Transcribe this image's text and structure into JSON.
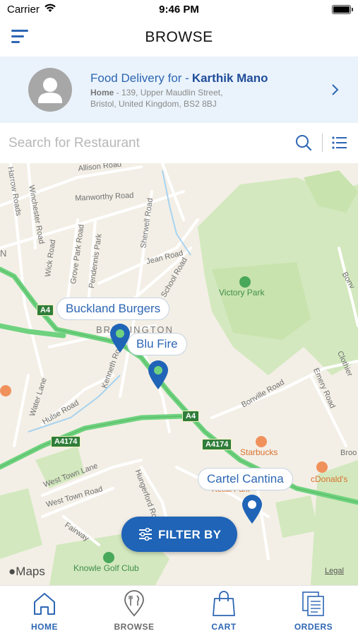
{
  "status_bar": {
    "carrier": "Carrier",
    "time": "9:46 PM"
  },
  "header": {
    "title": "BROWSE",
    "menu_icon": "hamburger-icon"
  },
  "delivery": {
    "prefix": "Food Delivery for -",
    "name": "Karthik Mano",
    "address_label": "Home",
    "address_line1": " - 139, Upper Maudlin Street,",
    "address_line2": "Bristol, United Kingdom, BS2 8BJ"
  },
  "search": {
    "placeholder": "Search for Restaurant"
  },
  "map": {
    "street_labels": {
      "allison": "Allison Road",
      "harrow": "Harrow Roads",
      "winchester": "Winchester Road",
      "manworthy": "Manworthy Road",
      "sherwell": "Sherwell Road",
      "wick": "Wick Road",
      "grove_park": "Grove Park Road",
      "pendennis": "Pendennis Park",
      "jean": "Jean Road",
      "school": "School Road",
      "kenneth": "Kenneth Road",
      "water": "Water Lane",
      "hulse": "Hulse Road",
      "bonville": "Bonville Road",
      "emery": "Emery Road",
      "west_town_lane": "West Town Lane",
      "west_town_road": "West Town Road",
      "fairway": "Fairway",
      "hungerford": "Hungerford Road",
      "clothier": "Clothier",
      "broo": "Broo",
      "bonv_top": "Bonv",
      "brislington": "BRISLINGTON",
      "n_mark": "N"
    },
    "road_badges": {
      "a4_1": "A4",
      "a4_2": "A4",
      "a4174_1": "A4174",
      "a4174_2": "A4174"
    },
    "pois": {
      "victory_park": "Victory Park",
      "starbucks": "Starbucks",
      "mcdonalds": "cDonald's",
      "knowle": "Knowle Golf Club",
      "retail_park": "Retail Park"
    },
    "restaurants": [
      "Buckland Burgers",
      "Blu Fire",
      "Cartel Cantina"
    ],
    "filter_label": "FILTER BY",
    "attribution_logo": "Maps",
    "legal": "Legal"
  },
  "tabs": [
    {
      "label": "HOME",
      "icon": "home-icon",
      "active": true
    },
    {
      "label": "BROWSE",
      "icon": "location-food-icon",
      "active": false
    },
    {
      "label": "CART",
      "icon": "shopping-bag-icon",
      "active": false
    },
    {
      "label": "ORDERS",
      "icon": "orders-document-icon",
      "active": false
    }
  ],
  "colors": {
    "primary": "#2d66b3",
    "banner_bg": "#eaf3fb",
    "map_bg": "#f3efe6",
    "park": "#cfe6b8",
    "major_road": "#7fdc8c",
    "filter_button": "#1f64b7",
    "inactive_tab": "#6a6a6a"
  }
}
